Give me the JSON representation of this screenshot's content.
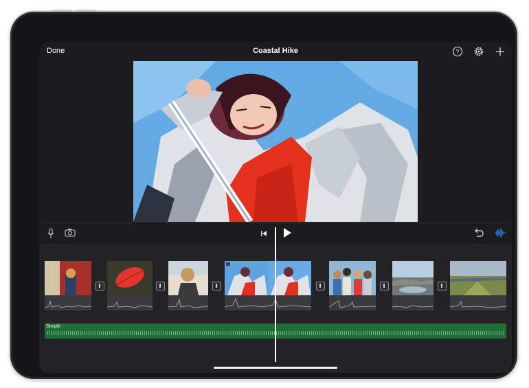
{
  "header": {
    "done_label": "Done",
    "project_title": "Coastal Hike"
  },
  "toolbar": {
    "help_icon": "question-circle-icon",
    "settings_icon": "gear-icon",
    "add_icon": "plus-icon"
  },
  "tools": {
    "mic_icon": "microphone-icon",
    "camera_icon": "camera-icon",
    "skip_back_icon": "skip-to-start-icon",
    "play_icon": "play-icon",
    "undo_icon": "undo-icon",
    "audio_icon": "waveform-icon"
  },
  "timeline": {
    "clips": [
      {
        "name": "clip-woman-window"
      },
      {
        "name": "clip-red-leaf"
      },
      {
        "name": "clip-woman-profile"
      },
      {
        "name": "clip-woman-jacket"
      },
      {
        "name": "clip-group-friends"
      },
      {
        "name": "clip-coastal-rocks"
      },
      {
        "name": "clip-grassy-plain"
      }
    ],
    "music_track_label": "Simple"
  },
  "colors": {
    "music_track": "#1e6f3a",
    "accent_blue": "#0a84ff",
    "background": "#1c1c1e"
  }
}
